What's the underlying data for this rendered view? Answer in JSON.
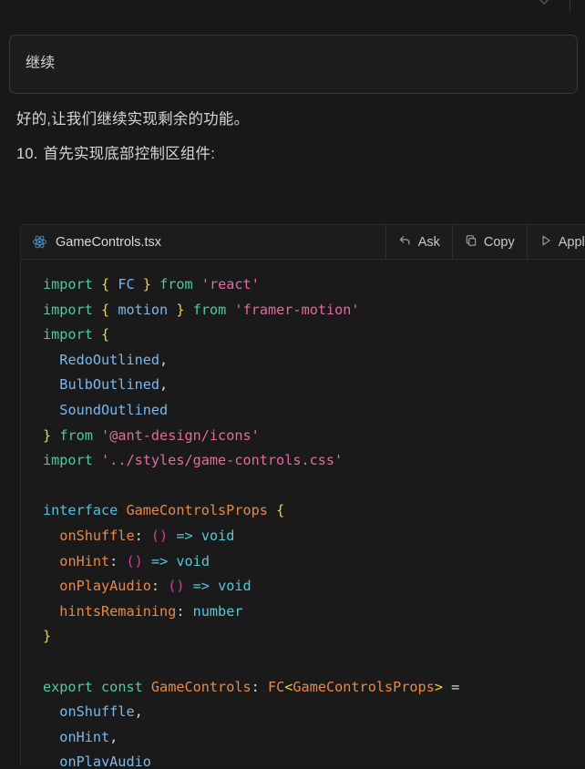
{
  "window": {
    "background": "#181818",
    "top_icon": "chevron-collapse-icon"
  },
  "prompt": {
    "value": "继续",
    "placeholder": "继续"
  },
  "answer": {
    "paragraph": "好的,让我们继续实现剩余的功能。",
    "list": [
      {
        "number": "10.",
        "text": "首先实现底部控制区组件:"
      }
    ]
  },
  "code_block": {
    "filename": "GameControls.tsx",
    "file_icon": "react-icon",
    "actions": [
      {
        "label": "Ask",
        "icon": "reply-arrow-icon"
      },
      {
        "label": "Copy",
        "icon": "copy-icon"
      },
      {
        "label": "Apply",
        "icon": "play-triangle-icon"
      }
    ],
    "language": "tsx",
    "lines": [
      [
        {
          "t": "kw",
          "s": "import"
        },
        {
          "t": "plain",
          "s": " "
        },
        {
          "t": "brace",
          "s": "{"
        },
        {
          "t": "plain",
          "s": " "
        },
        {
          "t": "ident",
          "s": "FC"
        },
        {
          "t": "plain",
          "s": " "
        },
        {
          "t": "brace",
          "s": "}"
        },
        {
          "t": "plain",
          "s": " "
        },
        {
          "t": "kw",
          "s": "from"
        },
        {
          "t": "plain",
          "s": " "
        },
        {
          "t": "str",
          "s": "'react'"
        }
      ],
      [
        {
          "t": "kw",
          "s": "import"
        },
        {
          "t": "plain",
          "s": " "
        },
        {
          "t": "brace",
          "s": "{"
        },
        {
          "t": "plain",
          "s": " "
        },
        {
          "t": "ident",
          "s": "motion"
        },
        {
          "t": "plain",
          "s": " "
        },
        {
          "t": "brace",
          "s": "}"
        },
        {
          "t": "plain",
          "s": " "
        },
        {
          "t": "kw",
          "s": "from"
        },
        {
          "t": "plain",
          "s": " "
        },
        {
          "t": "str",
          "s": "'framer-motion'"
        }
      ],
      [
        {
          "t": "kw",
          "s": "import"
        },
        {
          "t": "plain",
          "s": " "
        },
        {
          "t": "brace",
          "s": "{"
        }
      ],
      [
        {
          "t": "plain",
          "s": "  "
        },
        {
          "t": "ident",
          "s": "RedoOutlined"
        },
        {
          "t": "punc",
          "s": ","
        }
      ],
      [
        {
          "t": "plain",
          "s": "  "
        },
        {
          "t": "ident",
          "s": "BulbOutlined"
        },
        {
          "t": "punc",
          "s": ","
        }
      ],
      [
        {
          "t": "plain",
          "s": "  "
        },
        {
          "t": "ident",
          "s": "SoundOutlined"
        }
      ],
      [
        {
          "t": "brace",
          "s": "}"
        },
        {
          "t": "plain",
          "s": " "
        },
        {
          "t": "kw",
          "s": "from"
        },
        {
          "t": "plain",
          "s": " "
        },
        {
          "t": "str",
          "s": "'@ant-design/icons'"
        }
      ],
      [
        {
          "t": "kw",
          "s": "import"
        },
        {
          "t": "plain",
          "s": " "
        },
        {
          "t": "str",
          "s": "'../styles/game-controls.css'"
        }
      ],
      [],
      [
        {
          "t": "kw2",
          "s": "interface"
        },
        {
          "t": "plain",
          "s": " "
        },
        {
          "t": "type",
          "s": "GameControlsProps"
        },
        {
          "t": "plain",
          "s": " "
        },
        {
          "t": "brace",
          "s": "{"
        }
      ],
      [
        {
          "t": "plain",
          "s": "  "
        },
        {
          "t": "type",
          "s": "onShuffle"
        },
        {
          "t": "punc",
          "s": ":"
        },
        {
          "t": "plain",
          "s": " "
        },
        {
          "t": "paren",
          "s": "()"
        },
        {
          "t": "plain",
          "s": " "
        },
        {
          "t": "arrow",
          "s": "=>"
        },
        {
          "t": "plain",
          "s": " "
        },
        {
          "t": "prim",
          "s": "void"
        }
      ],
      [
        {
          "t": "plain",
          "s": "  "
        },
        {
          "t": "type",
          "s": "onHint"
        },
        {
          "t": "punc",
          "s": ":"
        },
        {
          "t": "plain",
          "s": " "
        },
        {
          "t": "paren",
          "s": "()"
        },
        {
          "t": "plain",
          "s": " "
        },
        {
          "t": "arrow",
          "s": "=>"
        },
        {
          "t": "plain",
          "s": " "
        },
        {
          "t": "prim",
          "s": "void"
        }
      ],
      [
        {
          "t": "plain",
          "s": "  "
        },
        {
          "t": "type",
          "s": "onPlayAudio"
        },
        {
          "t": "punc",
          "s": ":"
        },
        {
          "t": "plain",
          "s": " "
        },
        {
          "t": "paren",
          "s": "()"
        },
        {
          "t": "plain",
          "s": " "
        },
        {
          "t": "arrow",
          "s": "=>"
        },
        {
          "t": "plain",
          "s": " "
        },
        {
          "t": "prim",
          "s": "void"
        }
      ],
      [
        {
          "t": "plain",
          "s": "  "
        },
        {
          "t": "type",
          "s": "hintsRemaining"
        },
        {
          "t": "punc",
          "s": ":"
        },
        {
          "t": "plain",
          "s": " "
        },
        {
          "t": "prim",
          "s": "number"
        }
      ],
      [
        {
          "t": "brace",
          "s": "}"
        }
      ],
      [],
      [
        {
          "t": "kw",
          "s": "export"
        },
        {
          "t": "plain",
          "s": " "
        },
        {
          "t": "kw",
          "s": "const"
        },
        {
          "t": "plain",
          "s": " "
        },
        {
          "t": "type",
          "s": "GameControls"
        },
        {
          "t": "punc",
          "s": ":"
        },
        {
          "t": "plain",
          "s": " "
        },
        {
          "t": "type",
          "s": "FC"
        },
        {
          "t": "brace",
          "s": "<"
        },
        {
          "t": "type",
          "s": "GameControlsProps"
        },
        {
          "t": "brace",
          "s": ">"
        },
        {
          "t": "plain",
          "s": " "
        },
        {
          "t": "punc",
          "s": "="
        }
      ],
      [
        {
          "t": "plain",
          "s": "  "
        },
        {
          "t": "ident",
          "s": "onShuffle"
        },
        {
          "t": "punc",
          "s": ","
        }
      ],
      [
        {
          "t": "plain",
          "s": "  "
        },
        {
          "t": "ident",
          "s": "onHint"
        },
        {
          "t": "punc",
          "s": ","
        }
      ],
      [
        {
          "t": "plain",
          "s": "  "
        },
        {
          "t": "ident",
          "s": "onPlayAudio"
        }
      ]
    ]
  },
  "colors": {
    "background": "#181818",
    "code_background": "#1a1a1a",
    "border": "#2c2c2c",
    "text": "#d4d4d4",
    "keyword": "#4ec9a0",
    "interface_keyword": "#4fc1e0",
    "brace": "#e8d44d",
    "identifier": "#7cb7f0",
    "string": "#e06c9f",
    "type": "#e8884a",
    "paren": "#d43c9a",
    "primitive": "#56c8d8",
    "react_icon": "#4a90c2"
  }
}
